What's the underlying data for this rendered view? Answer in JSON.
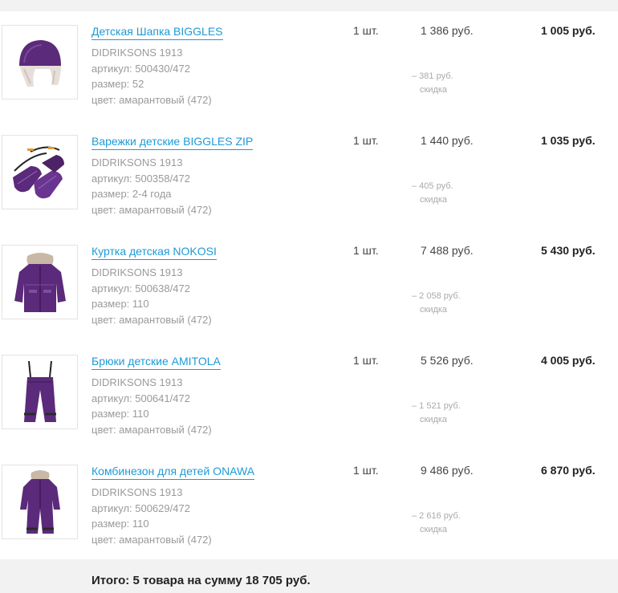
{
  "cart": {
    "items": [
      {
        "title": "Детская Шапка BIGGLES",
        "brand": "DIDRIKSONS 1913",
        "sku": "артикул: 500430/472",
        "size": "размер: 52",
        "color": "цвет: амарантовый (472)",
        "qty": "1 шт.",
        "price": "1 386 руб.",
        "discount": "– 381 руб.",
        "discount_label": "скидка",
        "total": "1 005 руб.",
        "icon": "hat-icon"
      },
      {
        "title": "Варежки детские BIGGLES ZIP",
        "brand": "DIDRIKSONS 1913",
        "sku": "артикул: 500358/472",
        "size": "размер: 2-4 года",
        "color": "цвет: амарантовый (472)",
        "qty": "1 шт.",
        "price": "1 440 руб.",
        "discount": "– 405 руб.",
        "discount_label": "скидка",
        "total": "1 035 руб.",
        "icon": "mittens-icon"
      },
      {
        "title": "Куртка детская NOKOSI",
        "brand": "DIDRIKSONS 1913",
        "sku": "артикул: 500638/472",
        "size": "размер: 110",
        "color": "цвет: амарантовый (472)",
        "qty": "1 шт.",
        "price": "7 488 руб.",
        "discount": "– 2 058 руб.",
        "discount_label": "скидка",
        "total": "5 430 руб.",
        "icon": "jacket-icon"
      },
      {
        "title": "Брюки детские AMITOLA",
        "brand": "DIDRIKSONS 1913",
        "sku": "артикул: 500641/472",
        "size": "размер: 110",
        "color": "цвет: амарантовый (472)",
        "qty": "1 шт.",
        "price": "5 526 руб.",
        "discount": "– 1 521 руб.",
        "discount_label": "скидка",
        "total": "4 005 руб.",
        "icon": "trousers-icon"
      },
      {
        "title": "Комбинезон для детей ONAWA",
        "brand": "DIDRIKSONS 1913",
        "sku": "артикул: 500629/472",
        "size": "размер: 110",
        "color": "цвет: амарантовый (472)",
        "qty": "1 шт.",
        "price": "9 486 руб.",
        "discount": "– 2 616 руб.",
        "discount_label": "скидка",
        "total": "6 870 руб.",
        "icon": "overall-icon"
      }
    ],
    "summary": "Итого: 5 товара на сумму 18 705 руб."
  },
  "colors": {
    "link": "#1e9ad6",
    "product_purple": "#5b2a7a",
    "footer_bg": "#f2f2f2"
  }
}
